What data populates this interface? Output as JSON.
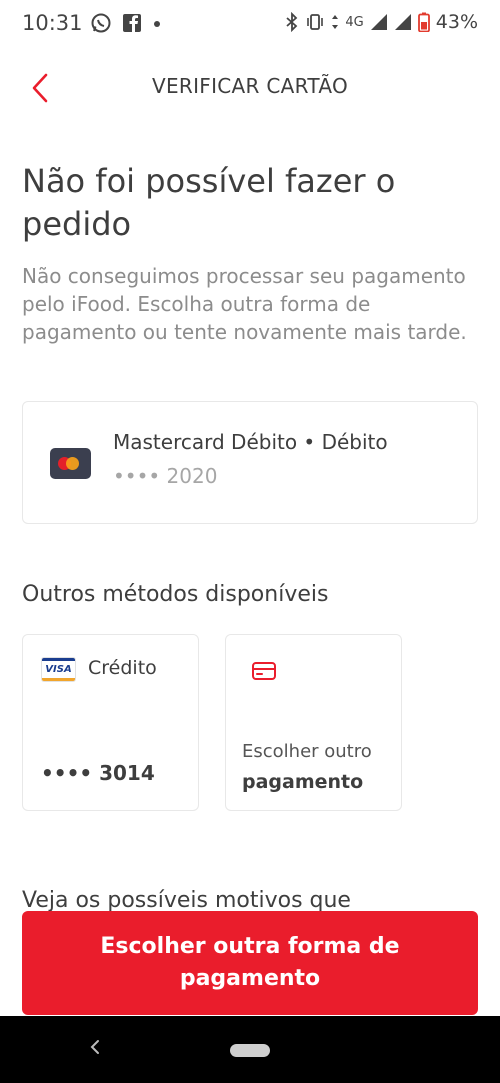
{
  "status_bar": {
    "time": "10:31",
    "network": "4G",
    "battery": "43%",
    "icons": [
      "whatsapp-icon",
      "facebook-icon",
      "dot-icon",
      "bluetooth-icon",
      "vibrate-icon",
      "signal-icon",
      "battery-icon"
    ]
  },
  "header": {
    "title": "VERIFICAR CARTÃO"
  },
  "main": {
    "heading": "Não foi possível fazer o pedido",
    "description": "Não conseguimos processar seu pagamento pelo iFood. Escolha outra forma de pagamento ou tente novamente mais tarde.",
    "current_card": {
      "name": "Mastercard Débito • Débito",
      "number": "•••• 2020"
    },
    "other_methods_title": "Outros métodos disponíveis",
    "methods": [
      {
        "brand": "VISA",
        "label": "Crédito",
        "number": "•••• 3014"
      },
      {
        "line1": "Escolher outro",
        "line2": "pagamento"
      }
    ],
    "reasons_title": "Veja os possíveis motivos que"
  },
  "cta": {
    "label": "Escolher outra forma de pagamento"
  },
  "colors": {
    "accent": "#ea1d2c",
    "text": "#3e3e3e",
    "muted": "#8c8c8c"
  }
}
